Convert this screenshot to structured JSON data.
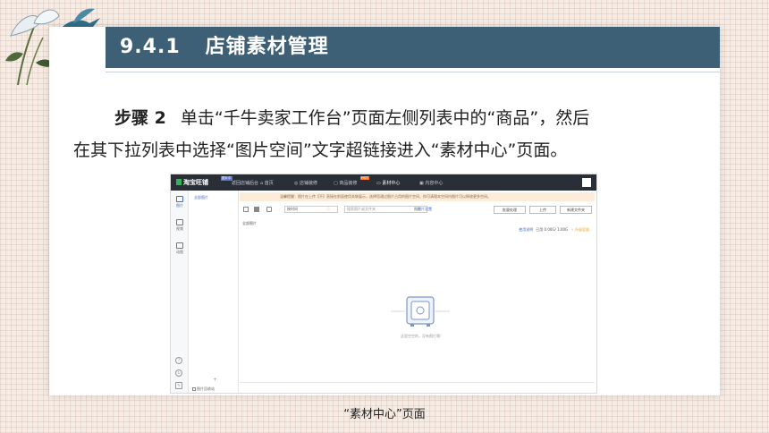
{
  "slide": {
    "section_number": "9.4.1",
    "section_title": "店铺素材管理",
    "step_label": "步骤 2",
    "paragraph_line1": "单击“千牛卖家工作台”页面左侧列表中的“商品”，然后",
    "paragraph_line2": "在其下拉列表中选择“图片空间”文字超链接进入“素材中心”页面。",
    "caption": "“素材中心”页面"
  },
  "screenshot": {
    "logo_text": "淘宝旺铺",
    "logo_badge": "图片中",
    "nav": [
      "返回店铺后台",
      "首页",
      "店铺装修",
      "商品装修",
      "素材中心",
      "内容中心"
    ],
    "hot_badge": "HOT",
    "active_nav": "素材中心",
    "notice": "温馨提醒：图片在上传【不】直接在前面使用关联展示，选择您通过图片占用的图片空间，你可清理本空间内图片可以释放更多空间。",
    "sidebar": [
      {
        "label": "图片",
        "icon": "image-icon",
        "active": true
      },
      {
        "label": "视频",
        "icon": "video-icon",
        "active": false
      },
      {
        "label": "动图",
        "icon": "gif-icon",
        "active": false
      }
    ],
    "folder_all": "全部图片",
    "folder_add": "+",
    "recycle_bin": "图片回收站",
    "sort_select": "按时间",
    "search_placeholder": "搜索图片或文件夹",
    "search_scope": "图片",
    "image_settings": "图片设置",
    "btn_new_folder": "新建文件夹",
    "btn_upload": "上传",
    "btn_batch": "批量处理",
    "breadcrumb": "全部图片",
    "usage_link": "使用说明",
    "usage_text": "已用 0.00G/ 1.00G",
    "upgrade": "升级容量",
    "empty_text": "这里空空的，没有图片哦！"
  },
  "colors": {
    "title_bar": "#3d6076",
    "top_nav_bg": "#2a2e37",
    "accent_link": "#3a6fd8",
    "notice_bg": "#fdecd9",
    "background_pattern": "#f6ece6"
  }
}
